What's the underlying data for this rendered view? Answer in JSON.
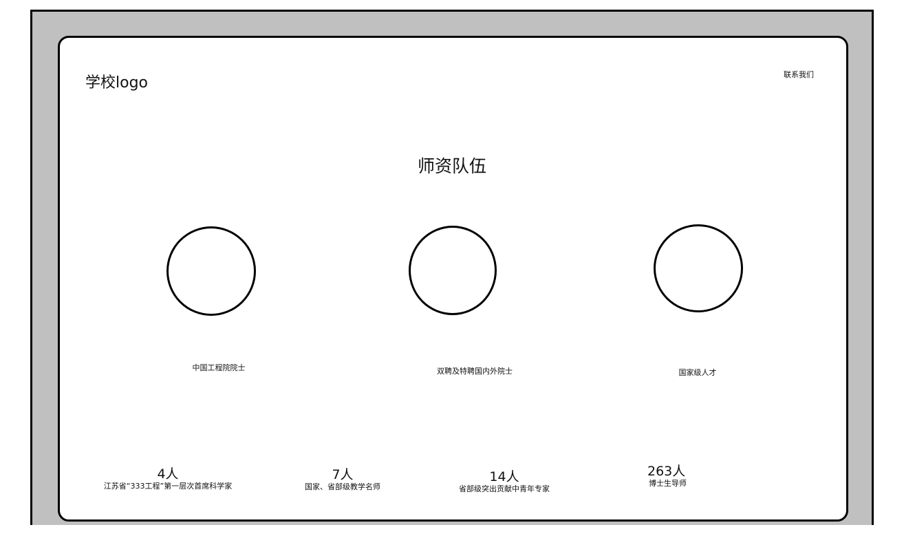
{
  "header": {
    "logo_text": "学校logo",
    "contact_label": "联系我们"
  },
  "section": {
    "title": "师资队伍"
  },
  "categories": [
    {
      "label": "中国工程院院士"
    },
    {
      "label": "双聘及特聘国内外院士"
    },
    {
      "label": "国家级人才"
    }
  ],
  "stats": [
    {
      "number": "4人",
      "description": "江苏省“333工程”第一层次首席科学家"
    },
    {
      "number": "7人",
      "description": "国家、省部级教学名师"
    },
    {
      "number": "14人",
      "description": "省部级突出贡献中青年专家"
    },
    {
      "number": "263人",
      "description": "博士生导师"
    }
  ]
}
